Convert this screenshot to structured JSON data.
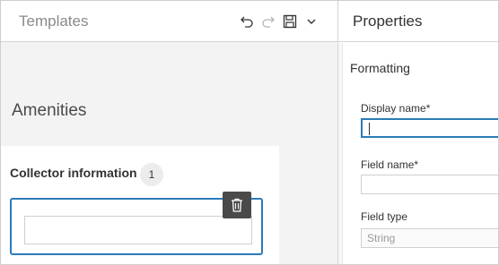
{
  "left_panel": {
    "title": "Templates",
    "toolbar": {
      "undo_icon": "undo-icon",
      "redo_icon": "redo-icon",
      "save_icon": "save-icon",
      "menu_icon": "chevron-down-icon"
    },
    "group_title": "Amenities",
    "card": {
      "title": "Collector information",
      "count": "1",
      "delete_icon": "trash-icon"
    }
  },
  "right_panel": {
    "title": "Properties",
    "section_title": "Formatting",
    "display_name": {
      "label": "Display name*",
      "value": ""
    },
    "field_name": {
      "label": "Field name*",
      "value": ""
    },
    "field_type": {
      "label": "Field type",
      "value": "String"
    }
  },
  "colors": {
    "accent": "#2b7bb9",
    "panel_bg": "#f3f3f3",
    "delete_bg": "#4a4a4a"
  }
}
